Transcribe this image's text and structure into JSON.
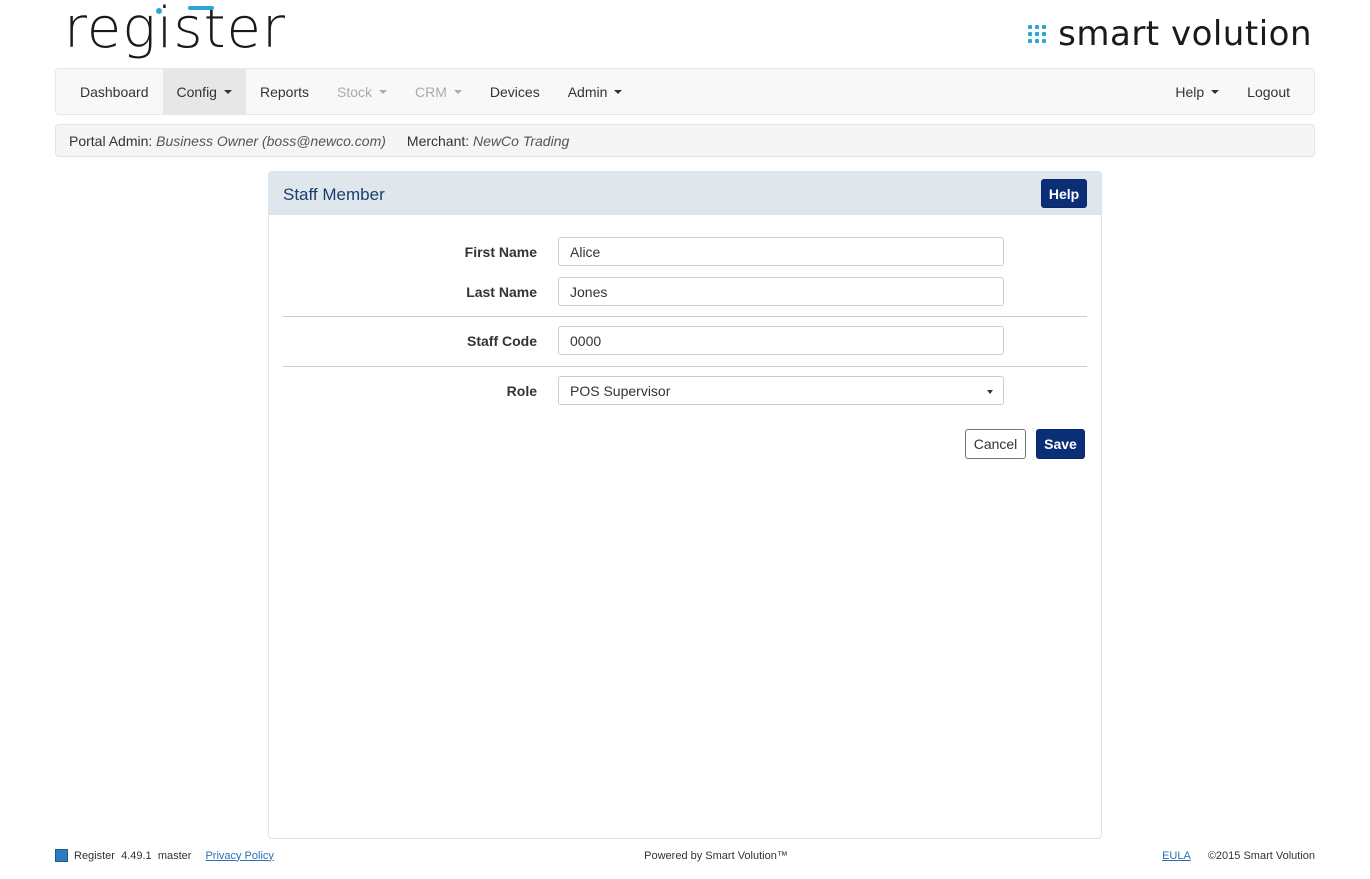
{
  "brand": {
    "register_logo": "register",
    "sv_logo": "smart volution"
  },
  "nav": {
    "left": [
      {
        "label": "Dashboard",
        "caret": false,
        "state": "normal"
      },
      {
        "label": "Config",
        "caret": true,
        "state": "active"
      },
      {
        "label": "Reports",
        "caret": false,
        "state": "normal"
      },
      {
        "label": "Stock",
        "caret": true,
        "state": "disabled"
      },
      {
        "label": "CRM",
        "caret": true,
        "state": "disabled"
      },
      {
        "label": "Devices",
        "caret": false,
        "state": "normal"
      },
      {
        "label": "Admin",
        "caret": true,
        "state": "normal"
      }
    ],
    "right": [
      {
        "label": "Help",
        "caret": true
      },
      {
        "label": "Logout",
        "caret": false
      }
    ]
  },
  "info": {
    "portal_label": "Portal Admin:",
    "portal_value": "Business Owner (boss@newco.com)",
    "merchant_label": "Merchant:",
    "merchant_value": "NewCo Trading"
  },
  "panel": {
    "title": "Staff Member",
    "help_label": "Help",
    "fields": {
      "first_name": {
        "label": "First Name",
        "value": "Alice"
      },
      "last_name": {
        "label": "Last Name",
        "value": "Jones"
      },
      "staff_code": {
        "label": "Staff Code",
        "value": "0000"
      },
      "role": {
        "label": "Role",
        "value": "POS Supervisor"
      }
    },
    "cancel_label": "Cancel",
    "save_label": "Save"
  },
  "footer": {
    "app_name": "Register",
    "version": "4.49.1",
    "branch": "master",
    "privacy_label": "Privacy Policy",
    "powered_by": "Powered by Smart Volution™",
    "eula_label": "EULA",
    "copyright": "©2015 Smart Volution"
  },
  "colors": {
    "primary_button": "#0b2f77",
    "accent": "#2aa5d4",
    "panel_header": "#dfe7ed",
    "panel_title": "#1a3e6e"
  }
}
